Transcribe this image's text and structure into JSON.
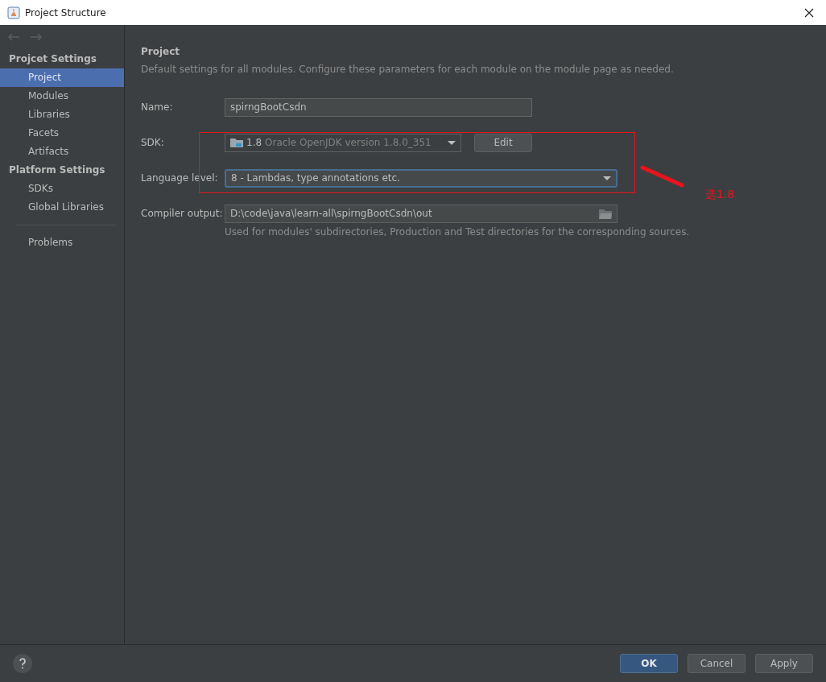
{
  "window": {
    "title": "Project Structure"
  },
  "sidebar": {
    "sections": [
      {
        "title": "Projcet Settings",
        "items": [
          {
            "label": "Project",
            "selected": true
          },
          {
            "label": "Modules",
            "selected": false
          },
          {
            "label": "Libraries",
            "selected": false
          },
          {
            "label": "Facets",
            "selected": false
          },
          {
            "label": "Artifacts",
            "selected": false
          }
        ]
      },
      {
        "title": "Platform Settings",
        "items": [
          {
            "label": "SDKs",
            "selected": false
          },
          {
            "label": "Global Libraries",
            "selected": false
          }
        ]
      }
    ],
    "extra_items": [
      {
        "label": "Problems",
        "selected": false
      }
    ]
  },
  "content": {
    "title": "Project",
    "description": "Default settings for all modules. Configure these parameters for each module on the module page as needed.",
    "fields": [
      {
        "kind": "text",
        "label": "Name:",
        "value": "spirngBootCsdn"
      },
      {
        "kind": "sdk",
        "label": "SDK:",
        "version": "1.8",
        "detail": "Oracle OpenJDK version 1.8.0_351",
        "button": "Edit"
      },
      {
        "kind": "select",
        "label": "Language level:",
        "value": "8 - Lambdas, type annotations etc.",
        "focused": true
      },
      {
        "kind": "path",
        "label": "Compiler output:",
        "value": "D:\\code\\java\\learn-all\\spirngBootCsdn\\out",
        "hint": "Used for modules' subdirectories, Production and Test directories for the corresponding sources."
      }
    ]
  },
  "annotation": {
    "text": "选1.8"
  },
  "footer": {
    "buttons": [
      {
        "label": "OK",
        "primary": true
      },
      {
        "label": "Cancel",
        "primary": false
      },
      {
        "label": "Apply",
        "primary": false
      }
    ]
  }
}
